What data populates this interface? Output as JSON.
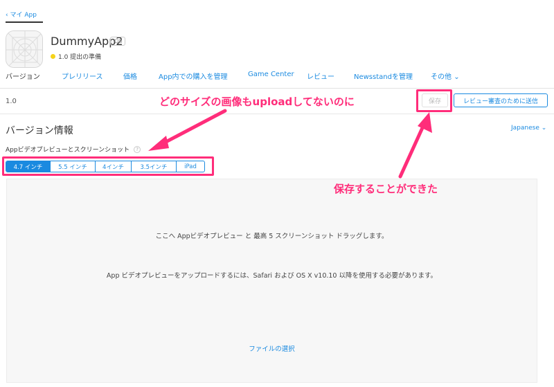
{
  "header": {
    "back_label": "マイ App",
    "app_name": "DummyApp2",
    "platform_badge": "iOS",
    "status_text": "1.0 提出の準備",
    "status_color": "#f5d31a"
  },
  "tabs": [
    {
      "label": "バージョン",
      "active": true
    },
    {
      "label": "プレリリース"
    },
    {
      "label": "価格"
    },
    {
      "label": "App内での購入を管理"
    },
    {
      "label": "Game Center"
    },
    {
      "label": "レビュー"
    },
    {
      "label": "Newsstandを管理"
    },
    {
      "label": "その他"
    }
  ],
  "version_bar": {
    "version": "1.0",
    "save_label": "保存",
    "submit_label": "レビュー審査のために送信"
  },
  "section": {
    "title": "バージョン情報",
    "language": "Japanese",
    "preview_label": "Appビデオプレビューとスクリーンショット",
    "help_glyph": "?"
  },
  "device_tabs": [
    {
      "label": "4.7 インチ",
      "selected": true
    },
    {
      "label": "5.5 インチ"
    },
    {
      "label": "4インチ"
    },
    {
      "label": "3.5インチ"
    },
    {
      "label": "iPad"
    }
  ],
  "dropzone": {
    "line1": "ここへ Appビデオプレビュー と 最高 5 スクリーンショット ドラッグします。",
    "line2": "App ビデオプレビューをアップロードするには、Safari および OS X v10.10 以降を使用する必要があります。",
    "choose_file": "ファイルの選択"
  },
  "annotations": {
    "top_note": "どのサイズの画像もuploadしてないのに",
    "save_note": "保存することができた",
    "color": "#ff2d7a"
  },
  "colors": {
    "accent": "#1a8ae0",
    "annotation": "#ff2d7a"
  }
}
